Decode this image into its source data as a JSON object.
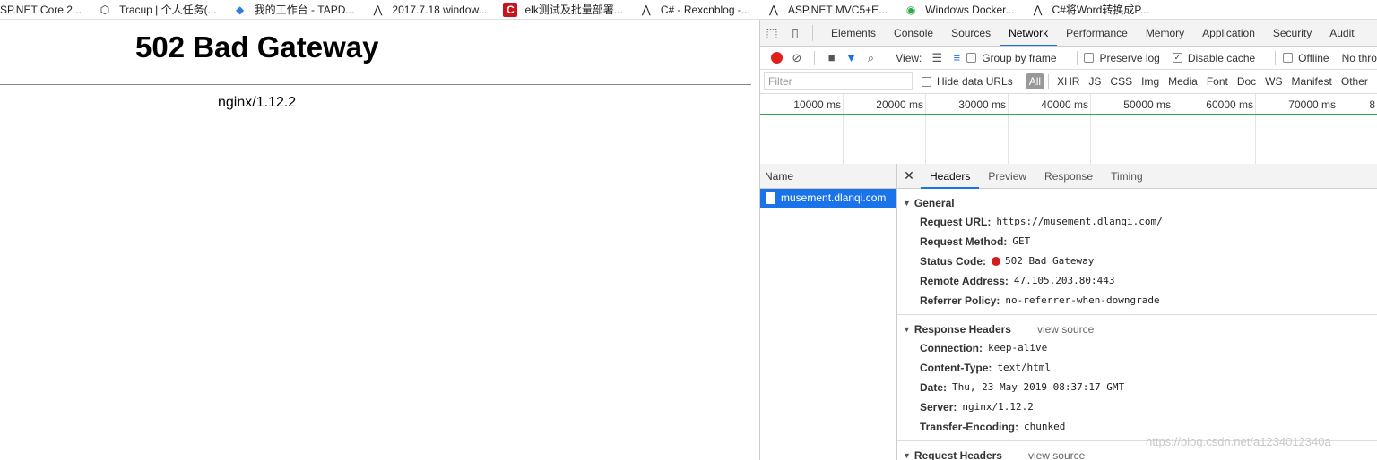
{
  "bookmarks": [
    {
      "icon": "page-icon",
      "label": "SP.NET Core 2..."
    },
    {
      "icon": "cube-icon",
      "label": "Tracup | 个人任务(..."
    },
    {
      "icon": "tapd-icon",
      "label": "我的工作台 - TAPD..."
    },
    {
      "icon": "page-icon",
      "label": "2017.7.18 window..."
    },
    {
      "icon": "csdn-icon",
      "label": "elk测试及批量部署..."
    },
    {
      "icon": "page-icon",
      "label": "C# - Rexcnblog -..."
    },
    {
      "icon": "page-icon",
      "label": "ASP.NET MVC5+E..."
    },
    {
      "icon": "docker-icon",
      "label": "Windows Docker..."
    },
    {
      "icon": "page-icon",
      "label": "C#将Word转换成P..."
    }
  ],
  "page": {
    "heading": "502 Bad Gateway",
    "server": "nginx/1.12.2"
  },
  "devtools": {
    "tabs": [
      "Elements",
      "Console",
      "Sources",
      "Network",
      "Performance",
      "Memory",
      "Application",
      "Security",
      "Audit"
    ],
    "active_tab": "Network",
    "toolbar": {
      "view_label": "View:",
      "group_by_frame": "Group by frame",
      "preserve_log": "Preserve log",
      "disable_cache": "Disable cache",
      "offline": "Offline",
      "throttling": "No thro"
    },
    "filter": {
      "placeholder": "Filter",
      "hide_data_urls": "Hide data URLs",
      "types": [
        "All",
        "XHR",
        "JS",
        "CSS",
        "Img",
        "Media",
        "Font",
        "Doc",
        "WS",
        "Manifest",
        "Other"
      ]
    },
    "timeline_ticks": [
      "10000 ms",
      "20000 ms",
      "30000 ms",
      "40000 ms",
      "50000 ms",
      "60000 ms",
      "70000 ms",
      "8"
    ],
    "name_header": "Name",
    "request_name": "musement.dlanqi.com",
    "detail_tabs": [
      "Headers",
      "Preview",
      "Response",
      "Timing"
    ],
    "general": {
      "title": "General",
      "rows": [
        {
          "k": "Request URL:",
          "v": "https://musement.dlanqi.com/"
        },
        {
          "k": "Request Method:",
          "v": "GET"
        },
        {
          "k": "Status Code:",
          "v": "502 Bad Gateway"
        },
        {
          "k": "Remote Address:",
          "v": "47.105.203.80:443"
        },
        {
          "k": "Referrer Policy:",
          "v": "no-referrer-when-downgrade"
        }
      ]
    },
    "response_headers": {
      "title": "Response Headers",
      "view_source": "view source",
      "rows": [
        {
          "k": "Connection:",
          "v": "keep-alive"
        },
        {
          "k": "Content-Type:",
          "v": "text/html"
        },
        {
          "k": "Date:",
          "v": "Thu, 23 May 2019 08:37:17 GMT"
        },
        {
          "k": "Server:",
          "v": "nginx/1.12.2"
        },
        {
          "k": "Transfer-Encoding:",
          "v": "chunked"
        }
      ]
    },
    "request_headers": {
      "title": "Request Headers",
      "view_source": "view source"
    }
  },
  "watermark": "https://blog.csdn.net/a1234012340a"
}
